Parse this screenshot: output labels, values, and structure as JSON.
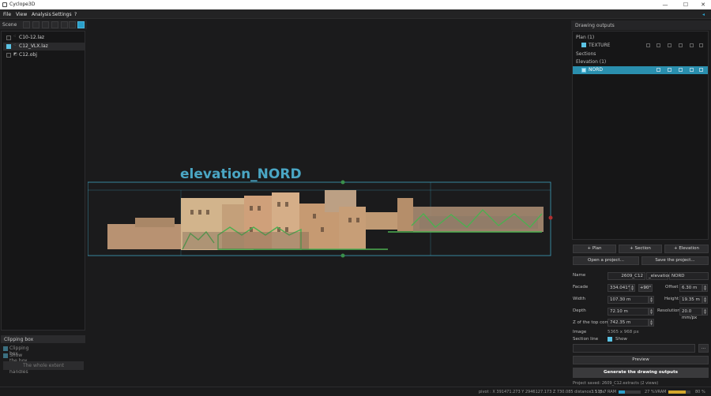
{
  "window": {
    "title": "Cyclope3D",
    "minimize": "—",
    "maximize": "☐",
    "close": "✕"
  },
  "menu": [
    "File",
    "View",
    "Analysis",
    "Settings",
    "?"
  ],
  "menu_right_icon": "◂",
  "scene": {
    "title": "Scene",
    "items": [
      {
        "label": "C10-12.laz",
        "checked": false,
        "icon": "point-cloud-icon"
      },
      {
        "label": "C12_VLX.laz",
        "checked": true,
        "icon": "point-cloud-icon"
      },
      {
        "label": "C12.obj",
        "checked": false,
        "icon": "mesh-icon"
      }
    ]
  },
  "clipping": {
    "title": "Clipping box",
    "option1": "Clipping box",
    "option2": "Show the box and its handles",
    "extent_button": "The whole extent"
  },
  "viewport": {
    "section_title": "elevation_NORD"
  },
  "drawings": {
    "title": "Drawing outputs",
    "plan_group": "Plan (1)",
    "plan_item": "TEXTURE",
    "sections_group": "Sections",
    "elevation_group": "Elevation (1)",
    "elevation_item": "NORD"
  },
  "buttons": {
    "add_plan": "+ Plan",
    "add_section": "+ Section",
    "add_elevation": "+ Elevation",
    "open_project": "Open a project...",
    "save_project": "Save the project...",
    "preview": "Preview",
    "generate": "Generate the drawing outputs",
    "browse": "..."
  },
  "form": {
    "name_label": "Name",
    "name_part1": "2609_C12",
    "name_part2": "_elevation_",
    "name_part3": "NORD",
    "facade_label": "Facade",
    "facade_value": "334.041°",
    "facade_rotate": "+90°",
    "offset_label": "Offset",
    "offset_value": "6.30 m",
    "width_label": "Width",
    "width_value": "107.30 m",
    "height_label": "Height",
    "height_value": "19.35 m",
    "depth_label": "Depth",
    "depth_value": "72.10 m",
    "resolution_label": "Resolution",
    "resolution_value": "20.0 mm/px",
    "ztop_label": "Z of the top corner",
    "ztop_value": "742.35 m",
    "image_label": "Image",
    "image_value": "5365 x 968 px",
    "section_line_label": "Section line",
    "section_line_show": "Show"
  },
  "status": {
    "left": "Project saved: 2609_C12.extracts (2 views)",
    "pivot": "pivot : X 391471.273  Y 2946127.173  Z 730.085  distance : 115.7",
    "fps": "3.5 fps",
    "ram_label": "RAM",
    "ram_pct": 0.27,
    "ram_value": "27 %",
    "vram_label": "VRAM",
    "vram_pct": 0.8,
    "vram_value": "80 %"
  },
  "colors": {
    "accent": "#2a9fc9",
    "section_green": "#4caf50",
    "section_line": "#3fa0bf"
  }
}
